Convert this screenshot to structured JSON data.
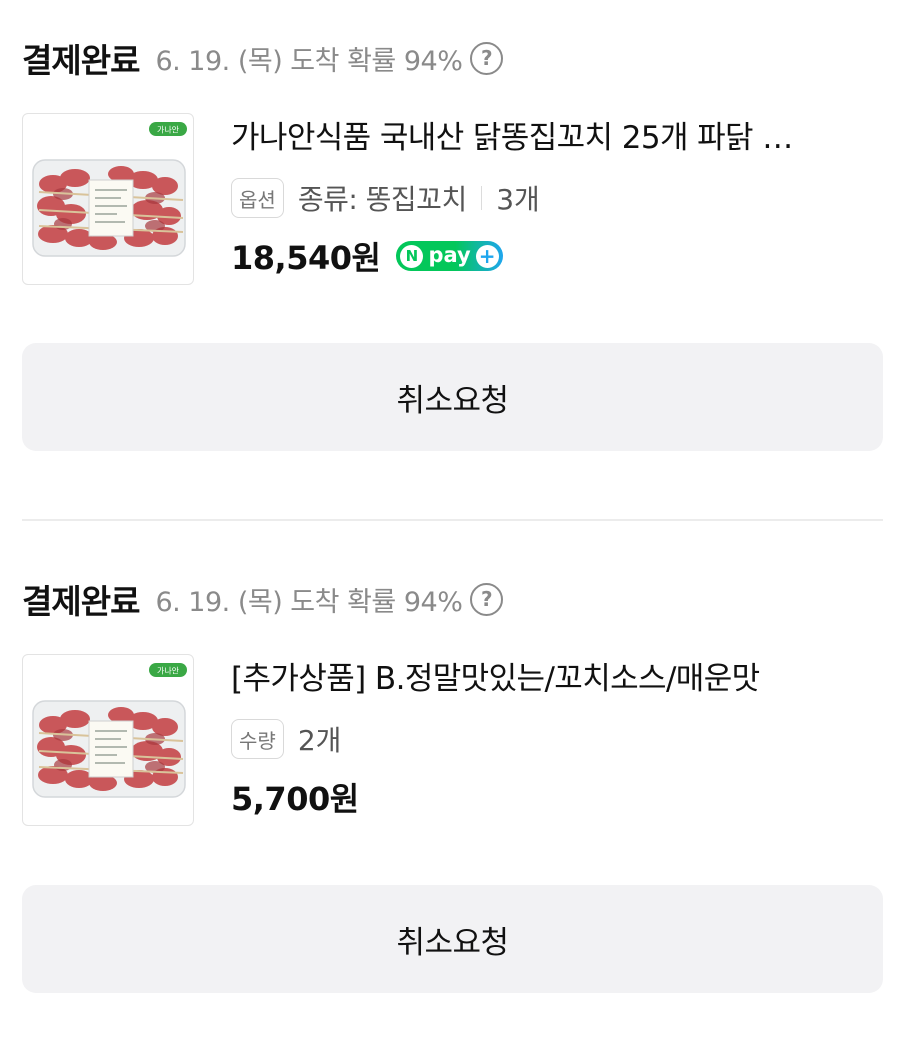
{
  "orders": [
    {
      "status": "결제완료",
      "delivery": "6. 19. (목) 도착 확률 94%",
      "help_icon": "?",
      "product_name": "가나안식품 국내산 닭똥집꼬치 25개 파닭 …",
      "option_chip": "옵션",
      "option_text": "종류: 똥집꼬치",
      "quantity": "3개",
      "price": "18,540원",
      "badge": {
        "n": "N",
        "text": "pay",
        "plus": "+"
      },
      "thumb_logo": "가나안",
      "cancel_label": "취소요청"
    },
    {
      "status": "결제완료",
      "delivery": "6. 19. (목) 도착 확률 94%",
      "help_icon": "?",
      "product_name": "[추가상품] B.정말맛있는/꼬치소스/매운맛",
      "option_chip": "수량",
      "quantity": "2개",
      "price": "5,700원",
      "thumb_logo": "가나안",
      "cancel_label": "취소요청"
    }
  ],
  "colors": {
    "npay_green": "#03c75a",
    "npay_blue": "#1fa6ee",
    "button_bg": "#f2f2f4",
    "muted_text": "#8a8a8a"
  }
}
